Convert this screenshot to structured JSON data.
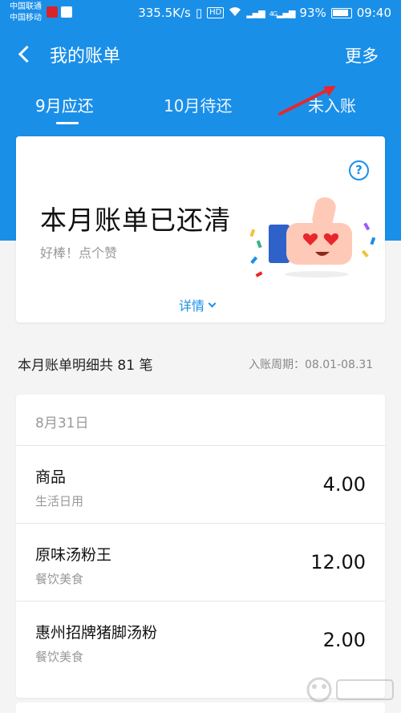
{
  "status_bar": {
    "carrier_1": "中国联通",
    "carrier_2": "中国移动",
    "speed": "335.5K/s",
    "hd": "HD",
    "signal_1": "4G",
    "battery": "93%",
    "time": "09:40"
  },
  "header": {
    "title": "我的账单",
    "more": "更多",
    "tabs": [
      {
        "label": "9月应还"
      },
      {
        "label": "10月待还"
      },
      {
        "label": "未入账"
      }
    ]
  },
  "summary_card": {
    "status": "本月账单已还清",
    "praise": "好棒！点个赞",
    "detail_label": "详情"
  },
  "summary": {
    "count_text": "本月账单明细共 81 笔",
    "period": "入账周期：08.01-08.31"
  },
  "list": {
    "date": "8月31日",
    "items": [
      {
        "name": "商品",
        "category": "生活日用",
        "amount": "4.00"
      },
      {
        "name": "原味汤粉王",
        "category": "餐饮美食",
        "amount": "12.00"
      },
      {
        "name": "惠州招牌猪脚汤粉",
        "category": "餐饮美食",
        "amount": "2.00"
      }
    ]
  },
  "colors": {
    "primary": "#1a8fe8",
    "annotation_arrow": "#e8262c"
  },
  "icons": {
    "back": "back-arrow-icon",
    "help": "help-circle-icon",
    "chevron": "chevron-down-icon",
    "thumb": "thumbs-up-emoji-illustration"
  }
}
